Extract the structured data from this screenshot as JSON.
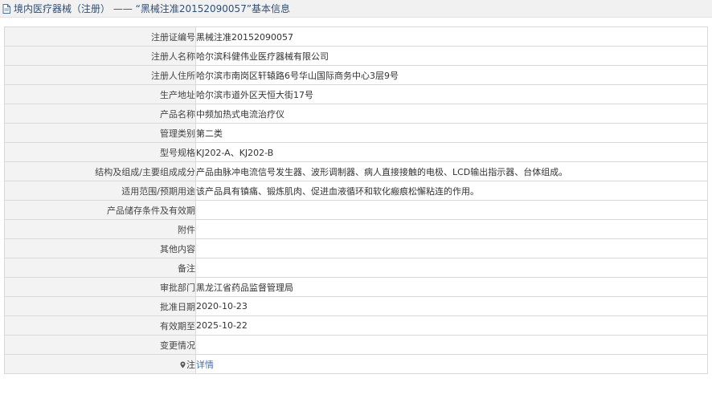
{
  "header": {
    "icon": "document-icon",
    "title": "境内医疗器械（注册） —— “黑械注准20152090057”基本信息"
  },
  "rows": [
    {
      "label": "注册证编号",
      "value": "黑械注准20152090057"
    },
    {
      "label": "注册人名称",
      "value": "哈尔滨科健伟业医疗器械有限公司"
    },
    {
      "label": "注册人住所",
      "value": "哈尔滨市南岗区轩辕路6号华山国际商务中心3层9号"
    },
    {
      "label": "生产地址",
      "value": "哈尔滨市道外区天恒大街17号"
    },
    {
      "label": "产品名称",
      "value": "中频加热式电流治疗仪"
    },
    {
      "label": "管理类别",
      "value": "第二类"
    },
    {
      "label": "型号规格",
      "value": "KJ202-A、KJ202-B"
    },
    {
      "label": "结构及组成/主要组成成分",
      "value": "产品由脉冲电流信号发生器、波形调制器、病人直接接触的电极、LCD输出指示器、台体组成。"
    },
    {
      "label": "适用范围/预期用途",
      "value": "该产品具有镇痛、锻炼肌肉、促进血液循环和软化瘢痕松懈粘连的作用。"
    },
    {
      "label": "产品储存条件及有效期",
      "value": ""
    },
    {
      "label": "附件",
      "value": ""
    },
    {
      "label": "其他内容",
      "value": ""
    },
    {
      "label": "备注",
      "value": ""
    },
    {
      "label": "审批部门",
      "value": "黑龙江省药品监督管理局"
    },
    {
      "label": "批准日期",
      "value": "2020-10-23"
    },
    {
      "label": "有效期至",
      "value": "2025-10-22"
    },
    {
      "label": "变更情况",
      "value": ""
    }
  ],
  "note_row": {
    "icon": "pin-icon",
    "label": "注",
    "link_text": "详情"
  }
}
